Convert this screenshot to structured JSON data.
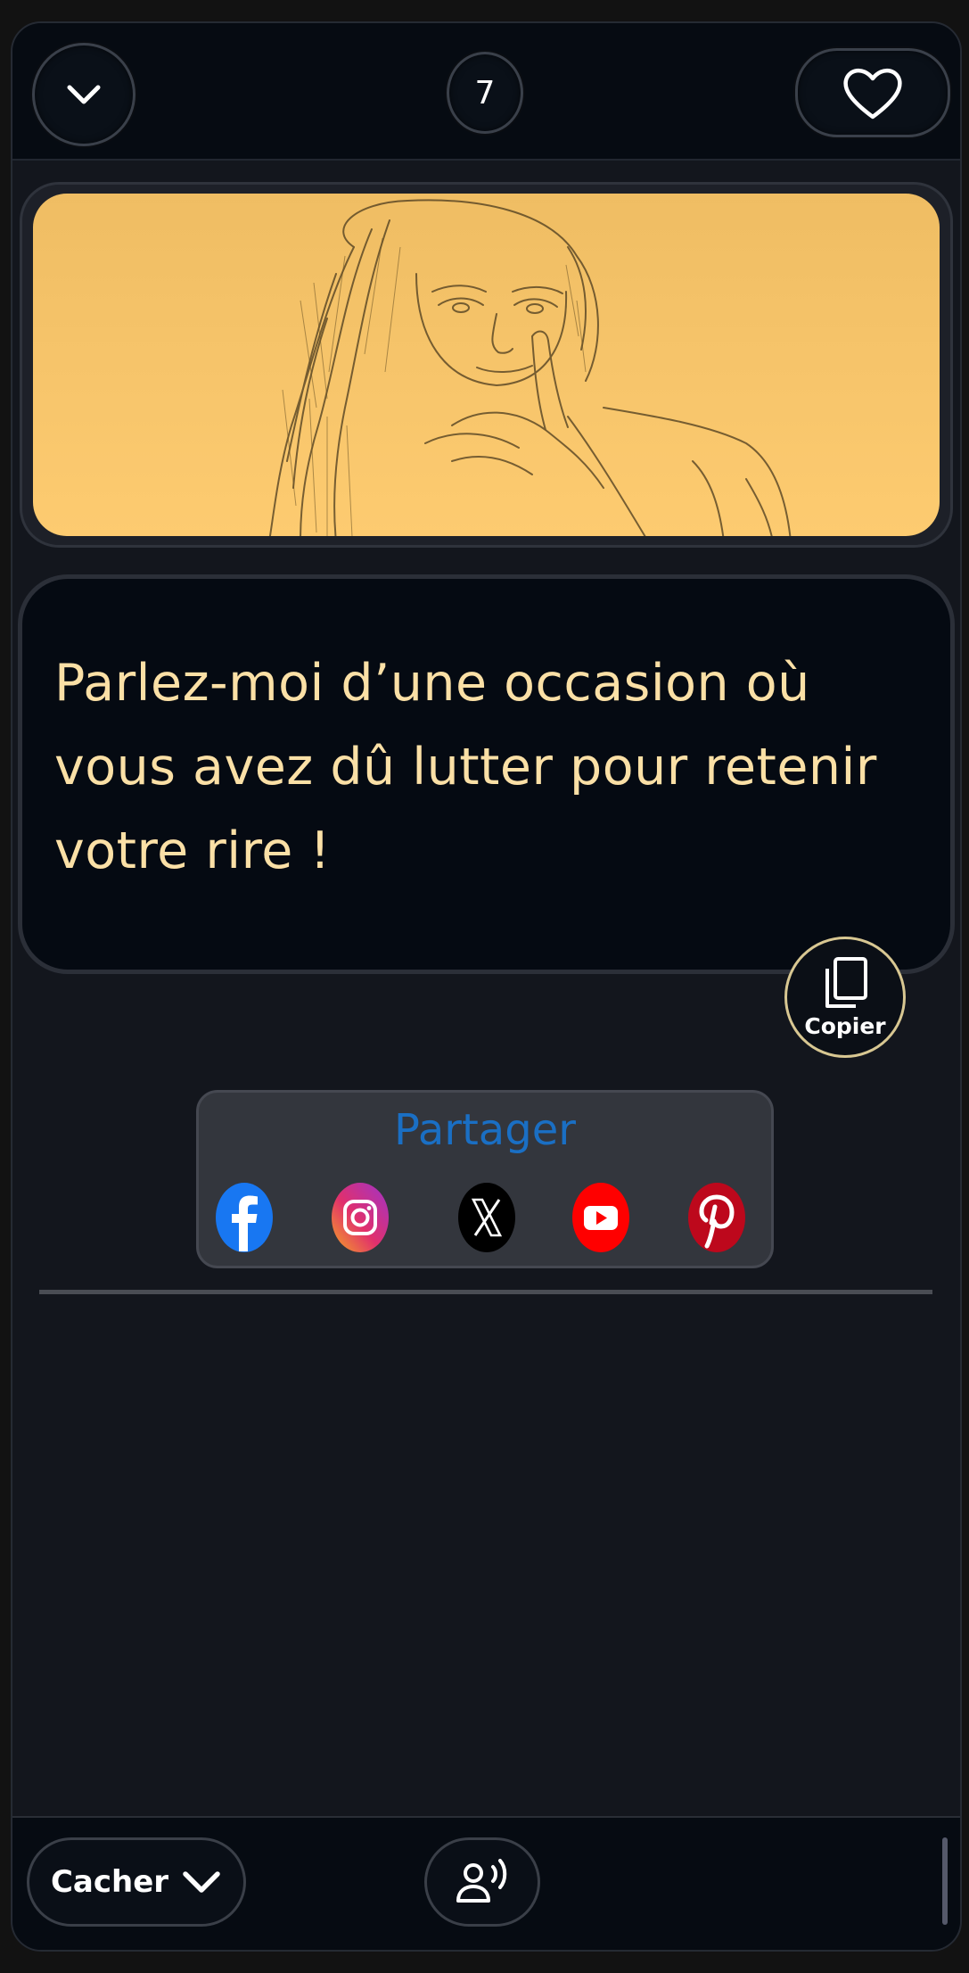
{
  "header": {
    "collapse_icon": "chevron-down-icon",
    "counter": "7",
    "favorite_icon": "heart-outline-icon"
  },
  "image": {
    "description_icon": "sketch-portrait",
    "background": "#f7c56b"
  },
  "quote": {
    "text": "Parlez-moi d’une occasion où vous avez dû lutter pour retenir votre rire !",
    "color": "#fbe0a6"
  },
  "copy": {
    "label": "Copier",
    "icon": "copy-icon"
  },
  "share": {
    "title": "Partager",
    "networks": [
      {
        "name": "facebook-icon",
        "color": "#1877f2"
      },
      {
        "name": "instagram-icon",
        "color": "#d6246e"
      },
      {
        "name": "x-icon",
        "color": "#000000"
      },
      {
        "name": "youtube-icon",
        "color": "#ff0000"
      },
      {
        "name": "pinterest-icon",
        "color": "#bd081c"
      }
    ]
  },
  "bottom": {
    "hide_label": "Cacher",
    "voice_icon": "voice-icon"
  }
}
